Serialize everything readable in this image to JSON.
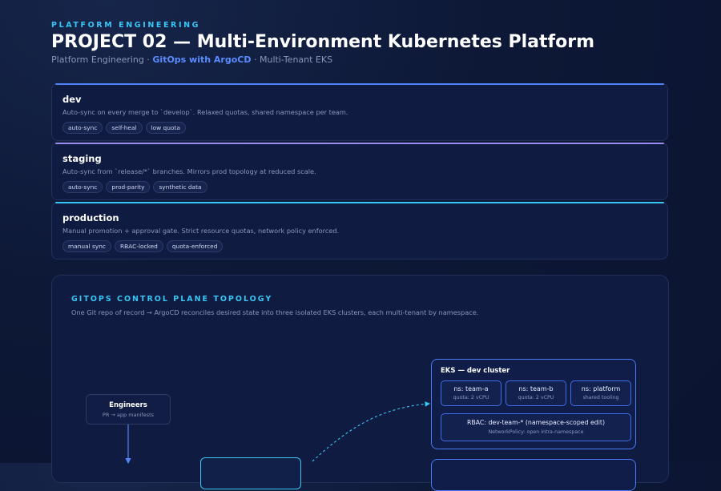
{
  "header": {
    "eyebrow": "PLATFORM ENGINEERING",
    "title": "PROJECT 02 — Multi-Environment Kubernetes Platform",
    "subtitle_prefix": "Platform Engineering ·",
    "subtitle_highlight": "GitOps with ArgoCD",
    "subtitle_suffix": "· Multi-Tenant EKS"
  },
  "environments": [
    {
      "name": "dev",
      "description": "Auto-sync on every merge to `develop`. Relaxed quotas, shared namespace per team.",
      "tags": [
        "auto-sync",
        "self-heal",
        "low quota"
      ],
      "accent": "#4f86f7"
    },
    {
      "name": "staging",
      "description": "Auto-sync from `release/*` branches. Mirrors prod topology at reduced scale.",
      "tags": [
        "auto-sync",
        "prod-parity",
        "synthetic data"
      ],
      "accent": "#9b8cf0"
    },
    {
      "name": "production",
      "description": "Manual promotion + approval gate. Strict resource quotas, network policy enforced.",
      "tags": [
        "manual sync",
        "RBAC-locked",
        "quota-enforced"
      ],
      "accent": "#38c6f4"
    }
  ],
  "topology": {
    "title": "GITOPS CONTROL PLANE TOPOLOGY",
    "description": "One Git repo of record → ArgoCD reconciles desired state into three isolated EKS clusters, each multi-tenant by namespace.",
    "engineers": {
      "title": "Engineers",
      "subtitle": "PR → app manifests"
    },
    "dev_cluster": {
      "title": "EKS — dev cluster",
      "namespaces": [
        {
          "name": "ns: team-a",
          "detail": "quota: 2 vCPU"
        },
        {
          "name": "ns: team-b",
          "detail": "quota: 2 vCPU"
        },
        {
          "name": "ns: platform",
          "detail": "shared tooling"
        }
      ],
      "rbac": {
        "title": "RBAC: dev-team-* (namespace-scoped edit)",
        "detail": "NetworkPolicy: open intra-namespace"
      }
    }
  },
  "colors": {
    "accent_cyan": "#38c6f4",
    "accent_blue": "#4f86f7",
    "accent_purple": "#9b8cf0",
    "background": "#0d1836"
  }
}
